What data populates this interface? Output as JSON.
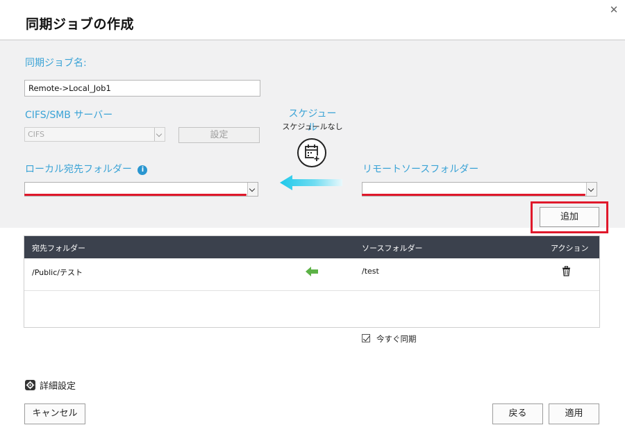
{
  "dialog": {
    "title": "同期ジョブの作成"
  },
  "job_name": {
    "label": "同期ジョブ名:",
    "value": "Remote->Local_Job1"
  },
  "server": {
    "label": "CIFS/SMB サーバー",
    "selected": "CIFS",
    "settings_label": "設定"
  },
  "schedule": {
    "title": "スケジュール",
    "status": "スケジュールなし"
  },
  "local_folder": {
    "label": "ローカル宛先フォルダー"
  },
  "remote_folder": {
    "label": "リモートソースフォルダー"
  },
  "add_label": "追加",
  "table": {
    "headers": [
      "宛先フォルダー",
      "ソースフォルダー",
      "アクション"
    ],
    "rows": [
      {
        "destination": "/Public/テスト",
        "source": "/test"
      }
    ]
  },
  "sync_now_label": "今すぐ同期",
  "advanced_label": "詳細設定",
  "footer": {
    "cancel_label": "キャンセル",
    "back_label": "戻る",
    "apply_label": "適用"
  },
  "colors": {
    "accent": "#3aa3d6",
    "highlight_red": "#e0182b",
    "table_header": "#3b414d",
    "arrow_green": "#5cb246",
    "arrow_cyan": "#1ec8ea"
  }
}
